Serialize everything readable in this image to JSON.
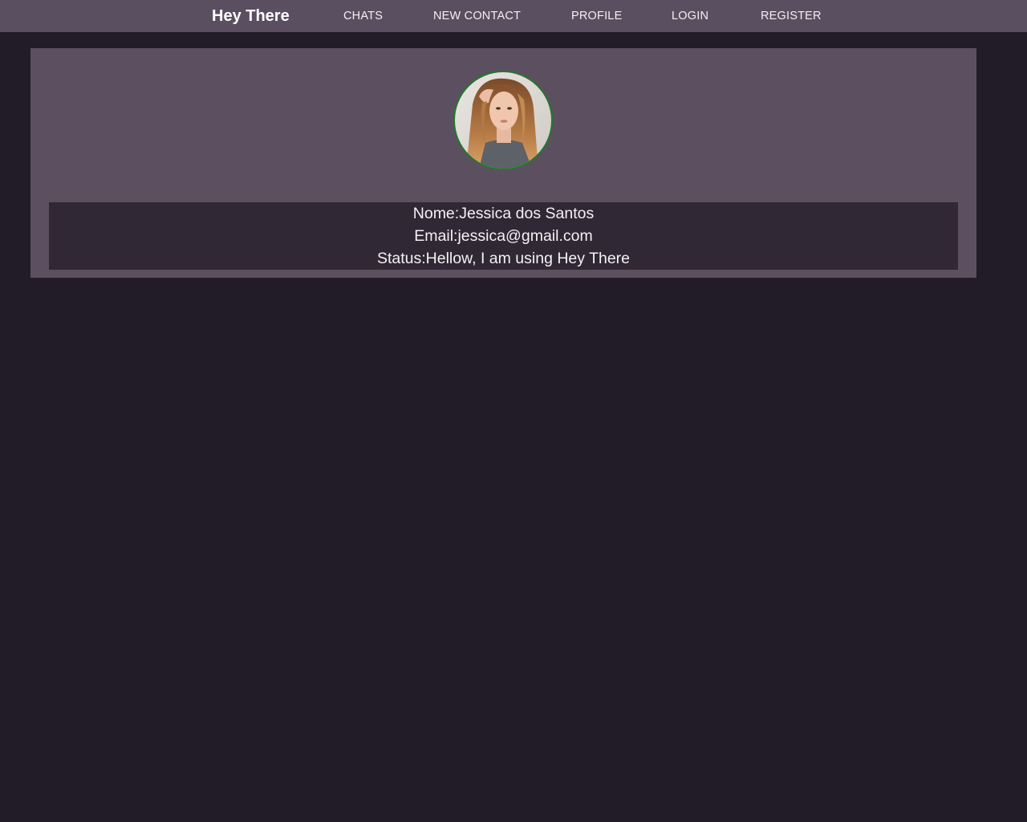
{
  "navbar": {
    "brand": "Hey There",
    "links": [
      {
        "label": "CHATS"
      },
      {
        "label": "NEW CONTACT"
      },
      {
        "label": "PROFILE"
      },
      {
        "label": "LOGIN"
      },
      {
        "label": "REGISTER"
      }
    ]
  },
  "profile": {
    "avatar_icon": "user-photo",
    "name_label": "Nome:",
    "name_value": "Jessica dos Santos",
    "email_label": "Email:",
    "email_value": "jessica@gmail.com",
    "status_label": "Status:",
    "status_value": "Hellow, I am using Hey There"
  },
  "colors": {
    "background": "#221c28",
    "navbar": "#5a4f60",
    "panel": "#5c5060",
    "info_box": "#302834",
    "avatar_border": "#1f7a2a"
  }
}
